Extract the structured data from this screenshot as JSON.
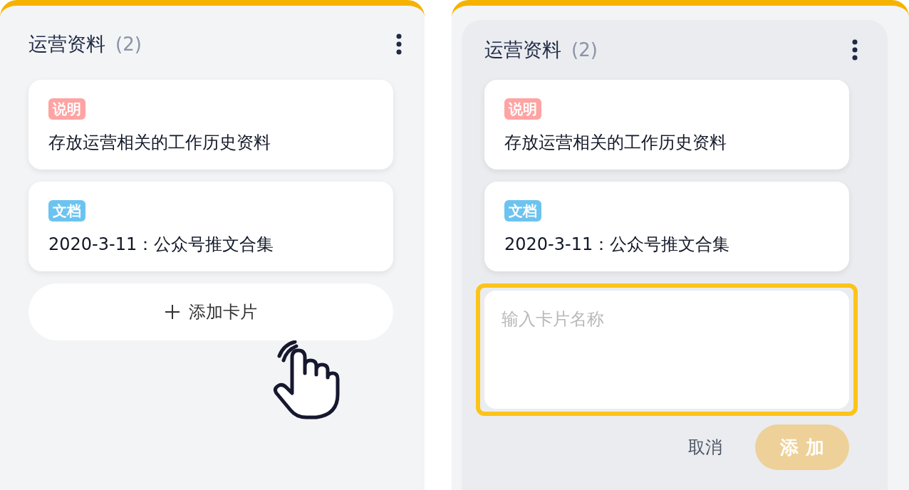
{
  "panels": [
    {
      "kind": "board",
      "header": {
        "title": "运营资料",
        "count": "(2)"
      },
      "cards": [
        {
          "tag": {
            "label": "说明",
            "color": "#ffa3a3"
          },
          "text": "存放运营相关的工作历史资料"
        },
        {
          "tag": {
            "label": "文档",
            "color": "#6cc3f0"
          },
          "text": "2020-3-11：公众号推文合集"
        }
      ],
      "add_button": {
        "label": "添加卡片"
      }
    },
    {
      "kind": "editing",
      "header": {
        "title": "运营资料",
        "count": "(2)"
      },
      "cards": [
        {
          "tag": {
            "label": "说明",
            "color": "#ffa3a3"
          },
          "text": "存放运营相关的工作历史资料"
        },
        {
          "tag": {
            "label": "文档",
            "color": "#6cc3f0"
          },
          "text": "2020-3-11：公众号推文合集"
        }
      ],
      "input": {
        "placeholder": "输入卡片名称",
        "focused": true
      },
      "cancel_button": "取消",
      "confirm_button": {
        "label": "添 加",
        "disabled": true
      }
    }
  ]
}
